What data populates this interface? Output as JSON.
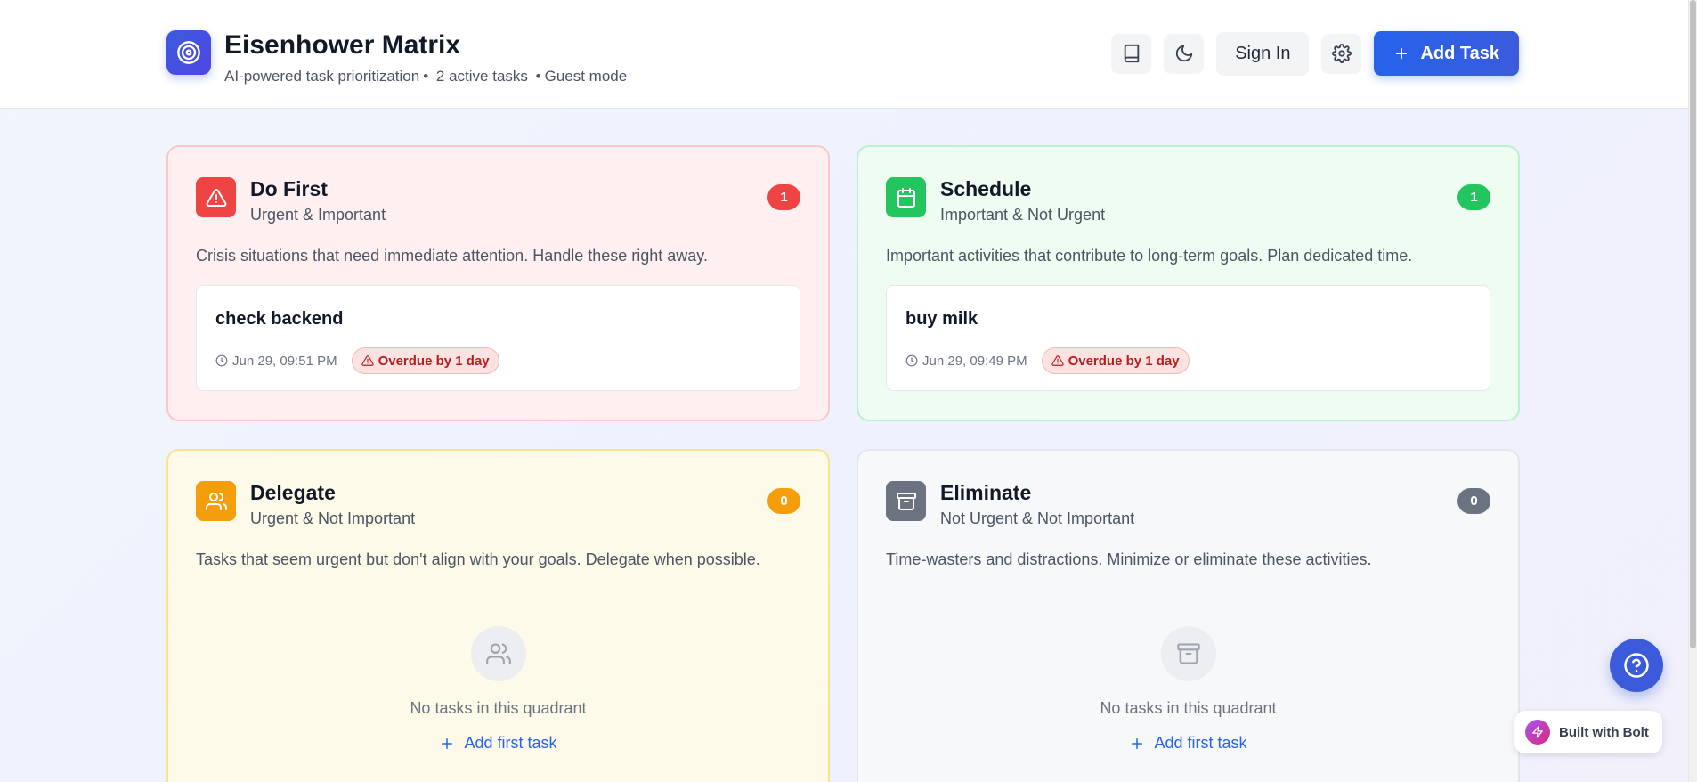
{
  "header": {
    "title": "Eisenhower Matrix",
    "subtitle_parts": [
      "AI-powered task prioritization",
      "•",
      "2 active tasks",
      "•",
      "Guest mode"
    ],
    "sign_in_label": "Sign In",
    "add_task_label": "Add Task",
    "icons": [
      "target-icon",
      "book-icon",
      "moon-icon",
      "gear-icon",
      "plus-icon"
    ]
  },
  "colors": {
    "accent": "#2563eb",
    "do_first": "#ef4444",
    "schedule": "#22c55e",
    "delegate": "#f59e0b",
    "eliminate": "#6b7280"
  },
  "quadrants": [
    {
      "title": "Do First",
      "subtitle": "Urgent & Important",
      "count": "1",
      "description": "Crisis situations that need immediate attention. Handle these right away.",
      "icon": "warning-triangle-icon",
      "tasks": [
        {
          "title": "check backend",
          "time": "Jun 29, 09:51 PM",
          "status": "Overdue by 1 day"
        }
      ]
    },
    {
      "title": "Schedule",
      "subtitle": "Important & Not Urgent",
      "count": "1",
      "description": "Important activities that contribute to long-term goals. Plan dedicated time.",
      "icon": "calendar-icon",
      "tasks": [
        {
          "title": "buy milk",
          "time": "Jun 29, 09:49 PM",
          "status": "Overdue by 1 day"
        }
      ]
    },
    {
      "title": "Delegate",
      "subtitle": "Urgent & Not Important",
      "count": "0",
      "description": "Tasks that seem urgent but don't align with your goals. Delegate when possible.",
      "icon": "users-icon",
      "empty_text": "No tasks in this quadrant",
      "add_first_label": "Add first task"
    },
    {
      "title": "Eliminate",
      "subtitle": "Not Urgent & Not Important",
      "count": "0",
      "description": "Time-wasters and distractions. Minimize or eliminate these activities.",
      "icon": "archive-icon",
      "empty_text": "No tasks in this quadrant",
      "add_first_label": "Add first task"
    }
  ],
  "footer": {
    "built_with_label": "Built with Bolt",
    "help_icon": "help-circle-icon"
  }
}
